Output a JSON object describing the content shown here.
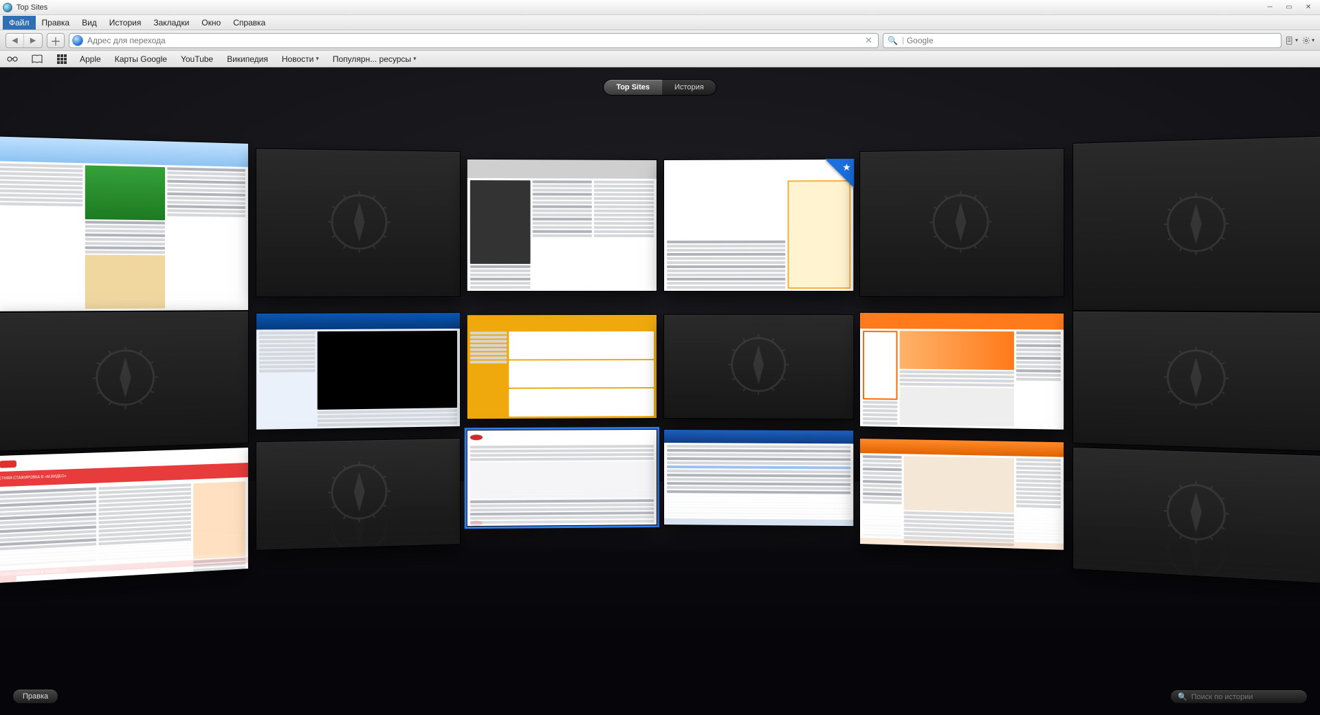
{
  "window": {
    "title": "Top Sites"
  },
  "menubar": [
    "Файл",
    "Правка",
    "Вид",
    "История",
    "Закладки",
    "Окно",
    "Справка"
  ],
  "activeMenuIndex": 0,
  "urlbar": {
    "placeholder": "Адрес для перехода"
  },
  "searchbar": {
    "engine": "Google",
    "placeholder": "Google"
  },
  "bookmarks": {
    "items": [
      "Apple",
      "Карты Google",
      "YouTube",
      "Википедия"
    ],
    "folders": [
      "Новости",
      "Популярн... ресурсы"
    ]
  },
  "switcher": {
    "left": "Top Sites",
    "right": "История",
    "activeIndex": 0
  },
  "editButton": "Правка",
  "historySearch": {
    "placeholder": "Поиск по истории"
  },
  "tiles": [
    {
      "kind": "site",
      "variant": "blueForum",
      "star": false,
      "selected": false
    },
    {
      "kind": "empty"
    },
    {
      "kind": "site",
      "variant": "newsGrey",
      "star": false,
      "selected": false
    },
    {
      "kind": "site",
      "variant": "yandex",
      "star": true,
      "selected": false
    },
    {
      "kind": "empty"
    },
    {
      "kind": "empty"
    },
    {
      "kind": "empty"
    },
    {
      "kind": "site",
      "variant": "tvBlue",
      "star": false,
      "selected": false
    },
    {
      "kind": "site",
      "variant": "kassir",
      "star": false,
      "selected": false
    },
    {
      "kind": "empty"
    },
    {
      "kind": "site",
      "variant": "travelOrange",
      "star": false,
      "selected": false
    },
    {
      "kind": "empty"
    },
    {
      "kind": "site",
      "variant": "hh",
      "star": false,
      "selected": false
    },
    {
      "kind": "empty"
    },
    {
      "kind": "site",
      "variant": "shopBlue",
      "star": false,
      "selected": true
    },
    {
      "kind": "site",
      "variant": "panelBlue",
      "star": false,
      "selected": false
    },
    {
      "kind": "site",
      "variant": "shopOrange",
      "star": false,
      "selected": false
    },
    {
      "kind": "empty"
    }
  ],
  "grid": {
    "cols": 6,
    "rows": 3,
    "colX": [
      20,
      380,
      680,
      965,
      1250,
      1560
    ],
    "colRotY": [
      20,
      11,
      3,
      -3,
      -11,
      -20
    ],
    "colHeightScale": [
      1.22,
      1.06,
      0.96,
      0.96,
      1.06,
      1.22
    ],
    "rowTopBase": [
      80,
      300,
      460
    ],
    "rowTopEdgeDelta": [
      -30,
      -6,
      32
    ],
    "rowMidHeight": [
      200,
      158,
      146
    ],
    "reflectRow": 2
  }
}
